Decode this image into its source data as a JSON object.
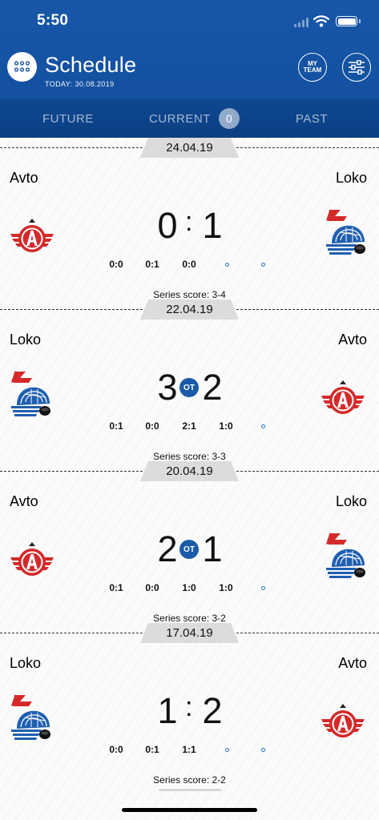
{
  "status_bar": {
    "time": "5:50"
  },
  "header": {
    "title": "Schedule",
    "today_label": "TODAY:",
    "today_date": "30.08.2019",
    "my_team_line1": "MY",
    "my_team_line2": "TEAM"
  },
  "tabs": [
    {
      "label": "FUTURE"
    },
    {
      "label": "CURRENT",
      "count": "0"
    },
    {
      "label": "PAST"
    }
  ],
  "colors": {
    "header": "#1857a8",
    "tabs": "#0e4791",
    "accent": "#1a5aa8",
    "avto_red": "#d42a2a",
    "loko_blue": "#1f5fb0"
  },
  "matches": [
    {
      "date": "24.04.19",
      "home": "Avto",
      "away": "Loko",
      "home_logo": "avto-logo",
      "away_logo": "loko-logo",
      "home_score": "0",
      "away_score": "1",
      "overtime": false,
      "separator": ":",
      "periods": [
        "0:0",
        "0:1",
        "0:0"
      ],
      "series": "Series score: 3-4"
    },
    {
      "date": "22.04.19",
      "home": "Loko",
      "away": "Avto",
      "home_logo": "loko-logo",
      "away_logo": "avto-logo",
      "home_score": "3",
      "away_score": "2",
      "overtime": true,
      "ot_label": "OT",
      "periods": [
        "0:1",
        "0:0",
        "2:1",
        "1:0"
      ],
      "series": "Series score: 3-3"
    },
    {
      "date": "20.04.19",
      "home": "Avto",
      "away": "Loko",
      "home_logo": "avto-logo",
      "away_logo": "loko-logo",
      "home_score": "2",
      "away_score": "1",
      "overtime": true,
      "ot_label": "OT",
      "periods": [
        "0:1",
        "0:0",
        "1:0",
        "1:0"
      ],
      "series": "Series score: 3-2"
    },
    {
      "date": "17.04.19",
      "home": "Loko",
      "away": "Avto",
      "home_logo": "loko-logo",
      "away_logo": "avto-logo",
      "home_score": "1",
      "away_score": "2",
      "overtime": false,
      "separator": ":",
      "periods": [
        "0:0",
        "0:1",
        "1:1"
      ],
      "series": "Series score: 2-2"
    }
  ]
}
